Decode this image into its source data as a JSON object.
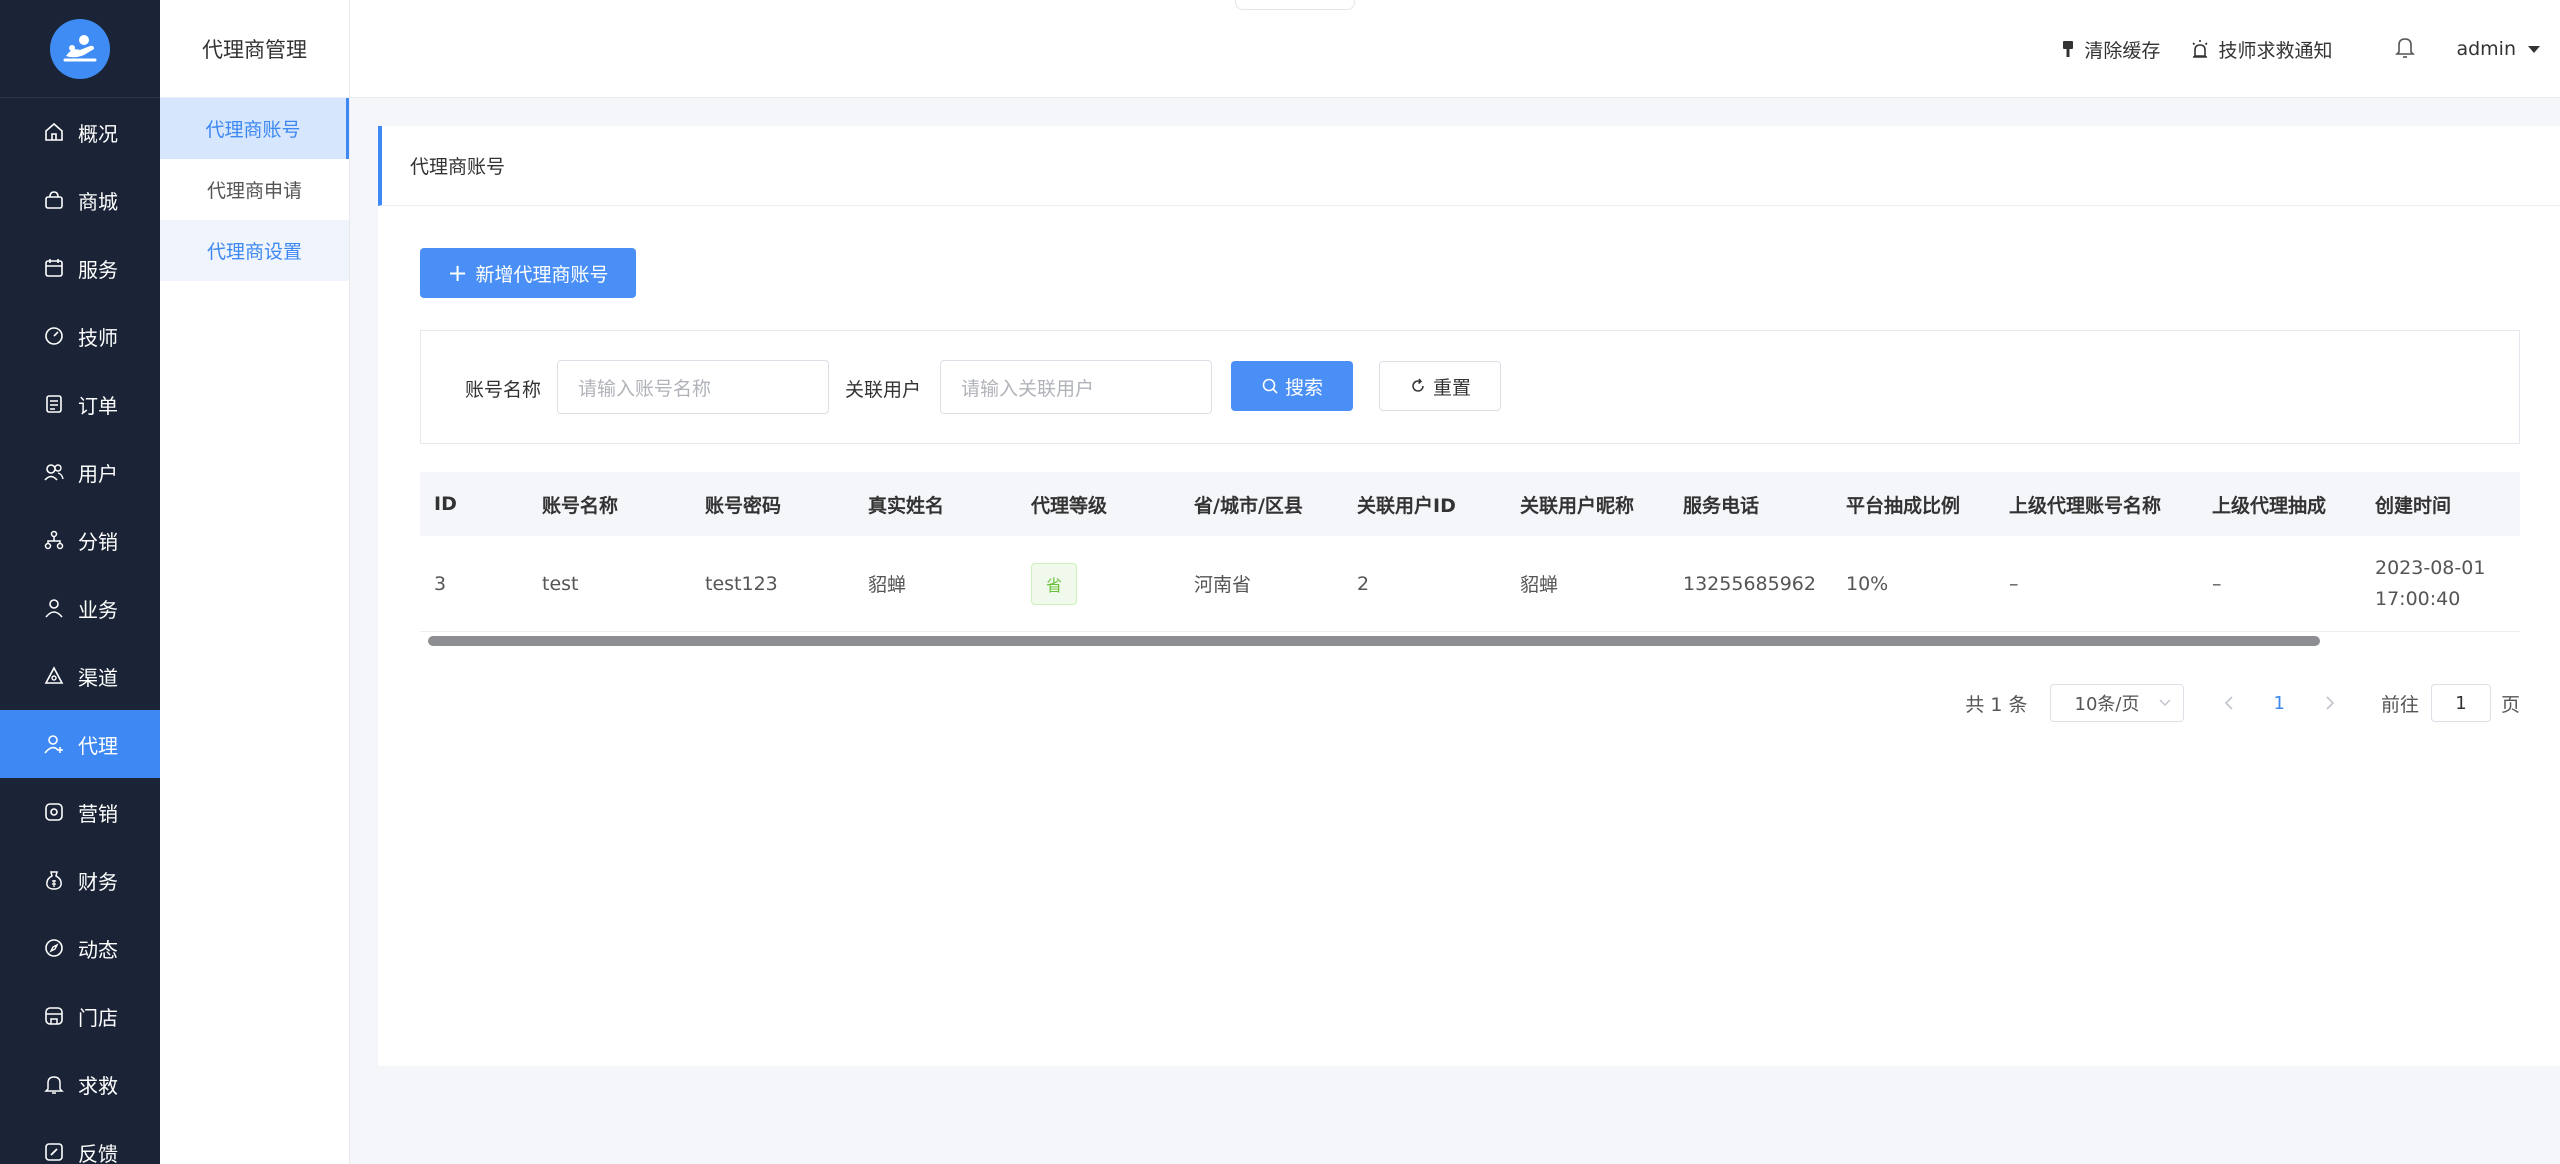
{
  "sidebar": {
    "items": [
      {
        "label": "概况",
        "icon": "home-icon"
      },
      {
        "label": "商城",
        "icon": "bag-icon"
      },
      {
        "label": "服务",
        "icon": "calendar-icon"
      },
      {
        "label": "技师",
        "icon": "gauge-icon"
      },
      {
        "label": "订单",
        "icon": "order-icon"
      },
      {
        "label": "用户",
        "icon": "users-icon"
      },
      {
        "label": "分销",
        "icon": "share-icon"
      },
      {
        "label": "业务",
        "icon": "person-icon"
      },
      {
        "label": "渠道",
        "icon": "channel-icon"
      },
      {
        "label": "代理",
        "icon": "agent-icon"
      },
      {
        "label": "营销",
        "icon": "marketing-icon"
      },
      {
        "label": "财务",
        "icon": "money-bag-icon"
      },
      {
        "label": "动态",
        "icon": "compass-icon"
      },
      {
        "label": "门店",
        "icon": "store-icon"
      },
      {
        "label": "求救",
        "icon": "bell-icon"
      },
      {
        "label": "反馈",
        "icon": "feedback-icon"
      }
    ],
    "active_index": 9,
    "accent": "#3d88f2"
  },
  "submenu": {
    "title": "代理商管理",
    "items": [
      {
        "label": "代理商账号"
      },
      {
        "label": "代理商申请"
      },
      {
        "label": "代理商设置"
      }
    ]
  },
  "header": {
    "clear_cache": "清除缓存",
    "sos_notice": "技师求救通知",
    "user": "admin"
  },
  "page": {
    "title": "代理商账号",
    "add_button": "新增代理商账号"
  },
  "search": {
    "account_label": "账号名称",
    "account_placeholder": "请输入账号名称",
    "user_label": "关联用户",
    "user_placeholder": "请输入关联用户",
    "search_button": "搜索",
    "reset_button": "重置"
  },
  "table": {
    "columns": [
      "ID",
      "账号名称",
      "账号密码",
      "真实姓名",
      "代理等级",
      "省/城市/区县",
      "关联用户ID",
      "关联用户昵称",
      "服务电话",
      "平台抽成比例",
      "上级代理账号名称",
      "上级代理抽成",
      "创建时间"
    ],
    "rows": [
      {
        "id": "3",
        "account": "test",
        "password": "test123",
        "real_name": "貂蝉",
        "level": "省",
        "region": "河南省",
        "user_id": "2",
        "user_nick": "貂蝉",
        "phone": "13255685962",
        "ratio": "10%",
        "parent_name": "–",
        "parent_ratio": "–",
        "created_date": "2023-08-01",
        "created_time": "17:00:40"
      }
    ]
  },
  "pager": {
    "total": "共 1 条",
    "page_size": "10条/页",
    "current": "1",
    "goto_label": "前往",
    "goto_value": "1",
    "page_suffix": "页"
  }
}
